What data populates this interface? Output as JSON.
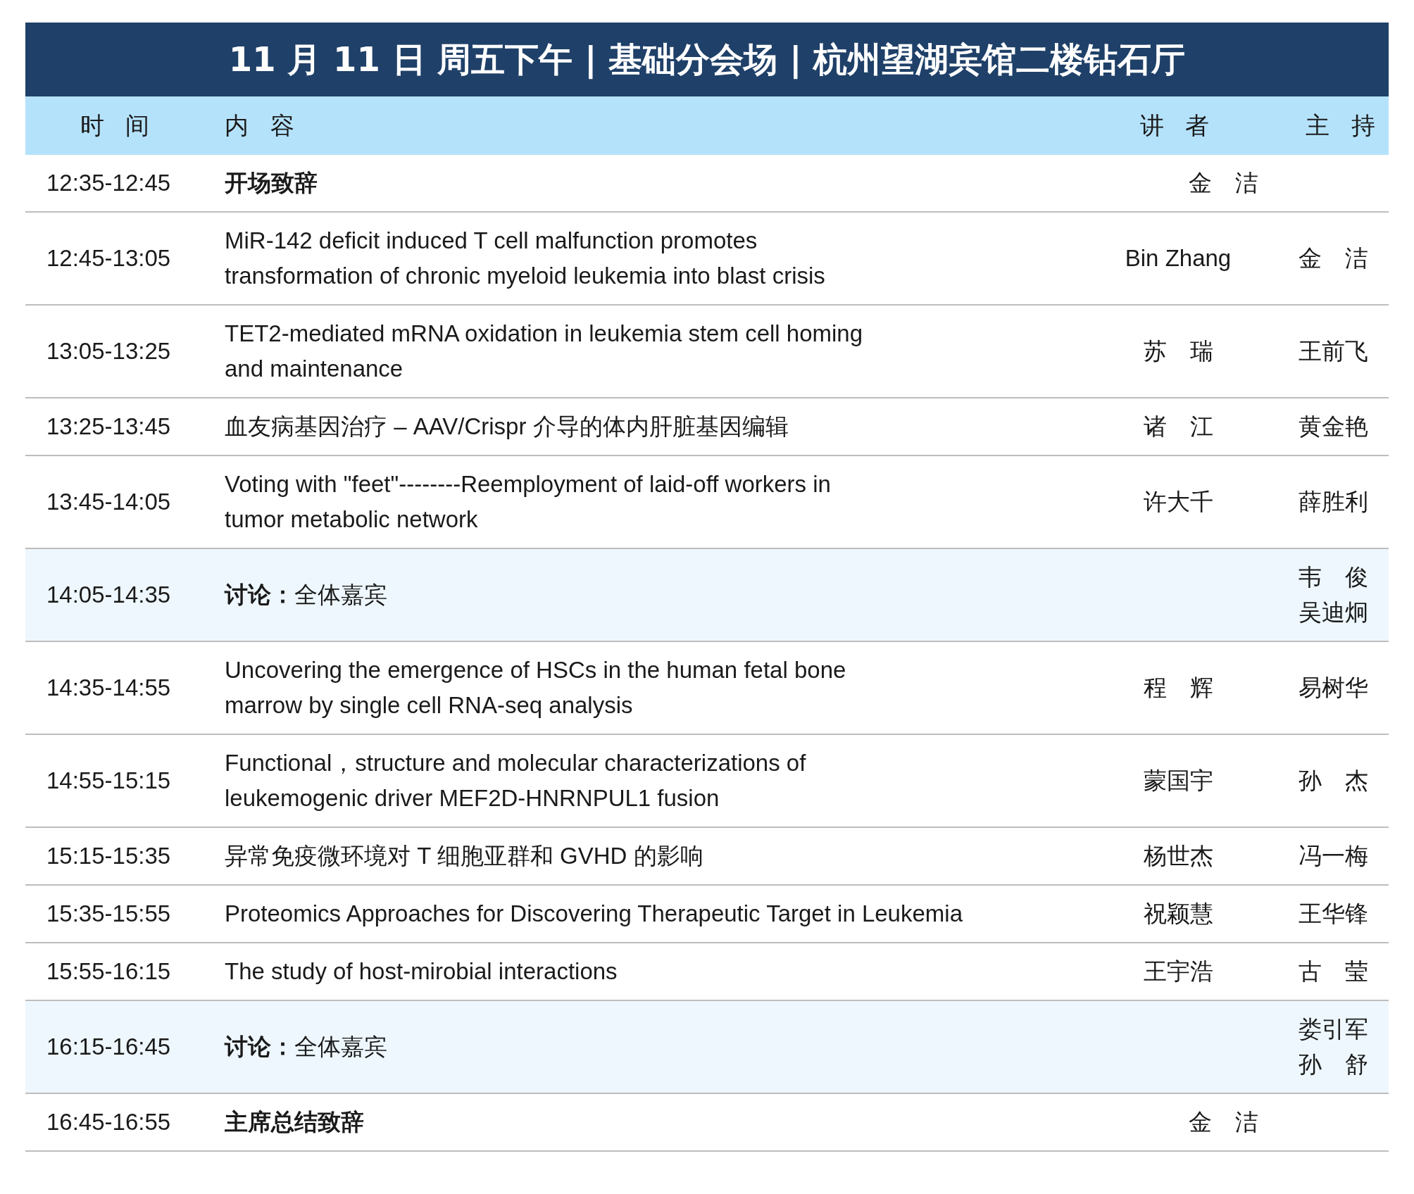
{
  "title": "11 月 11 日 周五下午 | 基础分会场 | 杭州望湖宾馆二楼钻石厅",
  "columns": [
    "时 间",
    "内 容",
    "讲 者",
    "主 持"
  ],
  "rows": [
    {
      "kind": "ceremony",
      "time": "12:35-12:45",
      "content": "开场致辞",
      "speaker": "金　洁",
      "hosts": []
    },
    {
      "kind": "talk",
      "time": "12:45-13:05",
      "content": "MiR-142 deficit induced T cell malfunction promotes\ntransformation of chronic myeloid leukemia into blast crisis",
      "speaker": "Bin Zhang",
      "hosts": [
        "金　洁"
      ]
    },
    {
      "kind": "talk",
      "time": "13:05-13:25",
      "content": "TET2-mediated mRNA oxidation in leukemia stem cell homing\nand maintenance",
      "speaker": "苏　瑞",
      "hosts": [
        "王前飞"
      ]
    },
    {
      "kind": "talk",
      "time": "13:25-13:45",
      "content": "血友病基因治疗 – AAV/Crispr 介导的体内肝脏基因编辑",
      "speaker": "诸　江",
      "hosts": [
        "黄金艳"
      ]
    },
    {
      "kind": "talk",
      "time": "13:45-14:05",
      "content": "Voting with \"feet\"--------Reemployment of laid-off workers in\ntumor metabolic network",
      "speaker": "许大千",
      "hosts": [
        "薛胜利"
      ]
    },
    {
      "kind": "discussion",
      "time": "14:05-14:35",
      "content": "**讨论：**全体嘉宾",
      "speaker": "",
      "hosts": [
        "韦　俊",
        "吴迪炯"
      ]
    },
    {
      "kind": "talk",
      "time": "14:35-14:55",
      "content": "Uncovering the emergence of HSCs in the human fetal bone\nmarrow by single cell RNA-seq analysis",
      "speaker": "程　辉",
      "hosts": [
        "易树华"
      ]
    },
    {
      "kind": "talk",
      "time": "14:55-15:15",
      "content": "Functional，structure and molecular characterizations of\nleukemogenic driver MEF2D-HNRNPUL1 fusion",
      "speaker": "蒙国宇",
      "hosts": [
        "孙　杰"
      ]
    },
    {
      "kind": "talk",
      "time": "15:15-15:35",
      "content": "异常免疫微环境对 T 细胞亚群和 GVHD 的影响",
      "speaker": "杨世杰",
      "hosts": [
        "冯一梅"
      ]
    },
    {
      "kind": "talk",
      "time": "15:35-15:55",
      "content": "Proteomics Approaches for Discovering Therapeutic Target in Leukemia",
      "speaker": "祝颖慧",
      "hosts": [
        "王华锋"
      ]
    },
    {
      "kind": "talk",
      "time": "15:55-16:15",
      "content": "The study of host-mirobial interactions",
      "speaker": "王宇浩",
      "hosts": [
        "古　莹"
      ]
    },
    {
      "kind": "discussion",
      "time": "16:15-16:45",
      "content": "**讨论：**全体嘉宾",
      "speaker": "",
      "hosts": [
        "娄引军",
        "孙　舒"
      ]
    },
    {
      "kind": "ceremony",
      "time": "16:45-16:55",
      "content": "主席总结致辞",
      "speaker": "金　洁",
      "hosts": []
    }
  ]
}
